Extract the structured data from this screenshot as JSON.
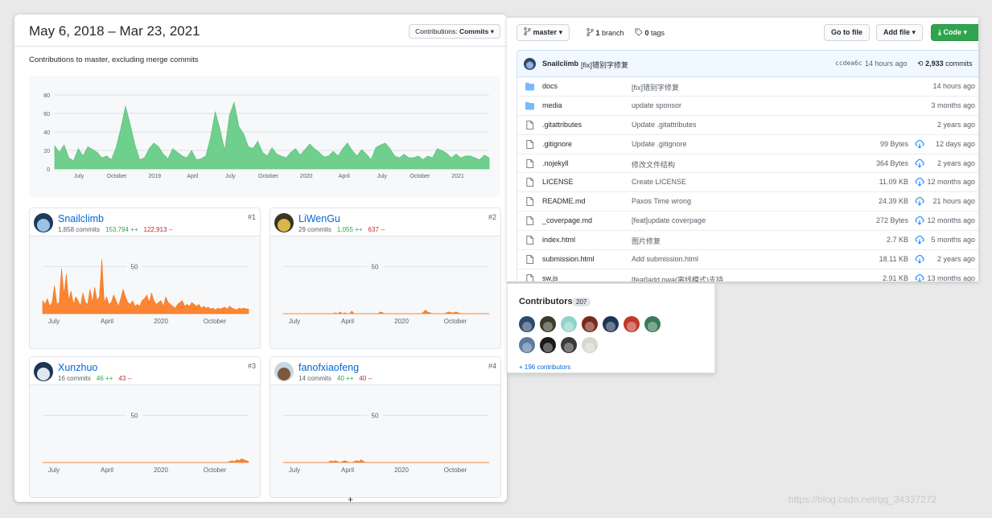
{
  "graph_page": {
    "date_range": "May 6, 2018 – Mar 23, 2021",
    "contributions_select_label": "Contributions:",
    "contributions_select_value": "Commits",
    "subtitle": "Contributions to master, excluding merge commits",
    "accent_green": "#6fcf8c",
    "accent_orange": "#fb8532"
  },
  "chart_data": [
    {
      "type": "area",
      "title": "",
      "series": [
        {
          "values": [
            25,
            18,
            26,
            12,
            9,
            22,
            14,
            24,
            21,
            18,
            12,
            14,
            10,
            23,
            44,
            68,
            48,
            26,
            10,
            12,
            22,
            28,
            24,
            16,
            11,
            22,
            18,
            14,
            12,
            20,
            10,
            11,
            14,
            34,
            62,
            43,
            20,
            58,
            72,
            46,
            38,
            24,
            22,
            30,
            18,
            14,
            23,
            16,
            14,
            12,
            18,
            22,
            15,
            21,
            27,
            22,
            18,
            13,
            14,
            19,
            14,
            22,
            28,
            20,
            14,
            21,
            16,
            10,
            23,
            26,
            28,
            22,
            14,
            12,
            16,
            12,
            12,
            14,
            10,
            14,
            12,
            22,
            20,
            17,
            12,
            16,
            12,
            14,
            14,
            12,
            10,
            15,
            12
          ]
        }
      ],
      "yticks": [
        0,
        20,
        40,
        60,
        80
      ],
      "xtick_labels": [
        "July",
        "October",
        "2019",
        "April",
        "July",
        "October",
        "2020",
        "April",
        "July",
        "October",
        "2021"
      ],
      "ylim": [
        0,
        80
      ]
    },
    {
      "type": "area",
      "title": "Snailclimb",
      "series": [
        {
          "values": [
            14,
            10,
            16,
            8,
            12,
            30,
            10,
            12,
            48,
            20,
            42,
            14,
            24,
            10,
            18,
            14,
            8,
            22,
            12,
            10,
            26,
            12,
            28,
            14,
            18,
            58,
            12,
            18,
            10,
            12,
            20,
            14,
            8,
            16,
            26,
            18,
            12,
            10,
            14,
            8,
            10,
            8,
            14,
            16,
            20,
            12,
            22,
            14,
            10,
            12,
            14,
            8,
            18,
            12,
            10,
            8,
            6,
            10,
            12,
            14,
            8,
            10,
            8,
            12,
            10,
            8,
            10,
            6,
            8,
            6,
            7,
            5,
            6,
            4,
            6,
            5,
            6,
            7,
            5,
            8,
            6,
            5,
            4,
            6,
            5,
            6,
            5,
            5
          ]
        }
      ],
      "yticks": [
        50
      ],
      "xtick_labels": [
        "July",
        "April",
        "2020",
        "October"
      ]
    },
    {
      "type": "area",
      "title": "LiWenGu",
      "series": [
        {
          "values": [
            0,
            0,
            0,
            0,
            0,
            0,
            0,
            0,
            0,
            0,
            0,
            0,
            0,
            0,
            0,
            0,
            0,
            0,
            0,
            0,
            0,
            0,
            1,
            0,
            2,
            0,
            1,
            0,
            0,
            3,
            0,
            0,
            0,
            0,
            0,
            0,
            0,
            0,
            0,
            0,
            0,
            2,
            1,
            0,
            0,
            0,
            0,
            0,
            0,
            0,
            0,
            0,
            0,
            0,
            0,
            0,
            0,
            0,
            0,
            1,
            4,
            2,
            1,
            0,
            0,
            0,
            0,
            0,
            0,
            1,
            2,
            1,
            1,
            2,
            1,
            0,
            0,
            0,
            0,
            0,
            0,
            0,
            0,
            0,
            0,
            0,
            0,
            0
          ]
        }
      ],
      "yticks": [
        50
      ],
      "xtick_labels": [
        "July",
        "April",
        "2020",
        "October"
      ]
    },
    {
      "type": "area",
      "title": "Xunzhuo",
      "series": [
        {
          "values": [
            0,
            0,
            0,
            0,
            0,
            0,
            0,
            0,
            0,
            0,
            0,
            0,
            0,
            0,
            0,
            0,
            0,
            0,
            0,
            0,
            0,
            0,
            0,
            0,
            0,
            0,
            0,
            0,
            0,
            0,
            0,
            0,
            0,
            0,
            0,
            0,
            0,
            0,
            0,
            0,
            0,
            0,
            0,
            0,
            0,
            0,
            0,
            0,
            0,
            0,
            0,
            0,
            0,
            0,
            0,
            0,
            0,
            0,
            0,
            0,
            0,
            0,
            0,
            0,
            0,
            0,
            0,
            0,
            0,
            0,
            0,
            0,
            0,
            0,
            0,
            0,
            0,
            0,
            0,
            1,
            2,
            1,
            3,
            2,
            4,
            3,
            2,
            1
          ]
        }
      ],
      "yticks": [
        50
      ],
      "xtick_labels": [
        "July",
        "April",
        "2020",
        "October"
      ]
    },
    {
      "type": "area",
      "title": "fanofxiaofeng",
      "series": [
        {
          "values": [
            0,
            0,
            0,
            0,
            0,
            0,
            0,
            0,
            0,
            0,
            0,
            0,
            0,
            0,
            0,
            0,
            0,
            0,
            0,
            0,
            2,
            1,
            2,
            1,
            0,
            1,
            2,
            1,
            0,
            0,
            1,
            2,
            1,
            3,
            1,
            0,
            0,
            0,
            0,
            0,
            0,
            0,
            0,
            0,
            0,
            0,
            0,
            0,
            0,
            0,
            0,
            0,
            0,
            0,
            0,
            0,
            0,
            0,
            0,
            0,
            0,
            0,
            0,
            0,
            0,
            0,
            0,
            0,
            0,
            0,
            0,
            0,
            0,
            0,
            0,
            0,
            0,
            0,
            0,
            0,
            0,
            0,
            0,
            0,
            0,
            0,
            0,
            0
          ]
        }
      ],
      "yticks": [
        50
      ],
      "xtick_labels": [
        "July",
        "April",
        "2020",
        "October"
      ]
    }
  ],
  "contributor_cards": [
    {
      "name": "Snailclimb",
      "commits": "1,858 commits",
      "additions": "153,794 ++",
      "deletions": "122,913 --",
      "rank": "#1"
    },
    {
      "name": "LiWenGu",
      "commits": "29 commits",
      "additions": "1,055 ++",
      "deletions": "637 --",
      "rank": "#2"
    },
    {
      "name": "Xunzhuo",
      "commits": "16 commits",
      "additions": "46 ++",
      "deletions": "43 --",
      "rank": "#3"
    },
    {
      "name": "fanofxiaofeng",
      "commits": "14 commits",
      "additions": "40 ++",
      "deletions": "40 --",
      "rank": "#4"
    }
  ],
  "repo": {
    "branch_button": "master",
    "branches": "1 branch",
    "branches_count": "1",
    "branches_word": "branch",
    "tags_count": "0",
    "tags_word": "tags",
    "go_to_file": "Go to file",
    "add_file": "Add file",
    "code_button": "Code",
    "latest_commit": {
      "author": "Snailclimb",
      "message": "[fix]错别字修复",
      "hash": "ccdea6c",
      "time": "14 hours ago",
      "count": "2,933",
      "count_word": "commits"
    },
    "files": [
      {
        "type": "folder",
        "name": "docs",
        "message": "[fix]错别字修复",
        "size": "",
        "time": "14 hours ago"
      },
      {
        "type": "folder",
        "name": "media",
        "message": "update sponsor",
        "size": "",
        "time": "3 months ago"
      },
      {
        "type": "file",
        "name": ".gitattributes",
        "message": "Update .gitattributes",
        "size": "",
        "time": "2 years ago"
      },
      {
        "type": "file",
        "name": ".gitignore",
        "message": "Update .gitignore",
        "size": "99 Bytes",
        "time": "12 days ago"
      },
      {
        "type": "file",
        "name": ".nojekyll",
        "message": "修改文件结构",
        "size": "364 Bytes",
        "time": "2 years ago"
      },
      {
        "type": "file",
        "name": "LICENSE",
        "message": "Create LICENSE",
        "size": "11.09 KB",
        "time": "12 months ago"
      },
      {
        "type": "file",
        "name": "README.md",
        "message": "Paxos Time wrong",
        "size": "24.39 KB",
        "time": "21 hours ago"
      },
      {
        "type": "file",
        "name": "_coverpage.md",
        "message": "[feat]update coverpage",
        "size": "272 Bytes",
        "time": "12 months ago"
      },
      {
        "type": "file",
        "name": "index.html",
        "message": "图片修复",
        "size": "2.7 KB",
        "time": "5 months ago"
      },
      {
        "type": "file",
        "name": "submission.html",
        "message": "Add submission.html",
        "size": "18.11 KB",
        "time": "2 years ago"
      },
      {
        "type": "file",
        "name": "sw.js",
        "message": "[feat]add pwa(离线模式)支持",
        "size": "2.91 KB",
        "time": "13 months ago"
      }
    ]
  },
  "contributors_box": {
    "title": "Contributors",
    "count": "207",
    "more_link": "+ 196 contributors",
    "avatar_colors": [
      "#2d4a6b",
      "#3b3b2a",
      "#8fd3c9",
      "#7a2a1a",
      "#1d3557",
      "#c0392b",
      "#3a7a5a",
      "#5a7aa0",
      "#1a1a1a",
      "#3a3a3a",
      "#d8d8d0"
    ]
  },
  "watermark": "https://blog.csdn.net/qq_34337272"
}
